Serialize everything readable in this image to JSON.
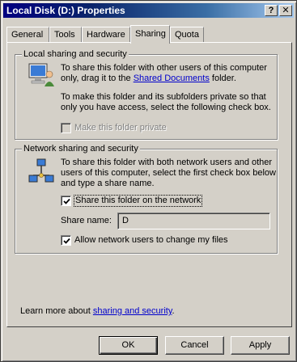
{
  "window": {
    "title": "Local Disk (D:) Properties"
  },
  "titlebar": {
    "help_label": "?",
    "close_label": "✕"
  },
  "tabs": [
    {
      "label": "General"
    },
    {
      "label": "Tools"
    },
    {
      "label": "Hardware"
    },
    {
      "label": "Sharing"
    },
    {
      "label": "Quota"
    }
  ],
  "active_tab": "Sharing",
  "local": {
    "heading": "Local sharing and security",
    "para1_line1": "To share this folder with other users of this computer",
    "para1_line2_prefix": "only, drag it to the ",
    "shared_link": "Shared Documents",
    "para1_line2_suffix": " folder.",
    "para2_line1": "To make this folder and its subfolders private so that",
    "para2_line2": "only you have access, select the following check box.",
    "private_label": "Make this folder private",
    "private_checked": false
  },
  "network": {
    "heading": "Network sharing and security",
    "para_line1": "To share this folder with both network users and other",
    "para_line2": "users of this computer, select the first check box below",
    "para_line3": "and type a share name.",
    "share_label": "Share this folder on the network",
    "share_checked": true,
    "share_name_label": "Share name:",
    "share_name_value": "D",
    "allow_label": "Allow network users to change my files",
    "allow_checked": true
  },
  "footer": {
    "learn_prefix": "Learn more about ",
    "learn_link": "sharing and security",
    "learn_suffix": "."
  },
  "buttons": {
    "ok": "OK",
    "cancel": "Cancel",
    "apply": "Apply"
  },
  "colors": {
    "title_start": "#000080",
    "title_end": "#a6caf0",
    "face": "#d4d0c8",
    "link": "#0000cc"
  }
}
